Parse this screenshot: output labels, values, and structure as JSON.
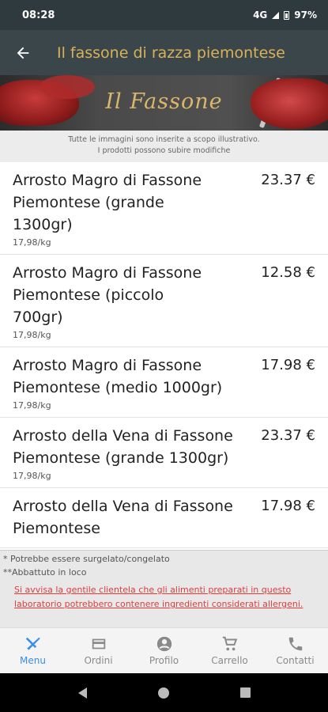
{
  "status": {
    "time": "08:28",
    "network": "4G",
    "battery": "97%"
  },
  "appbar": {
    "title": "Il fassone di razza piemontese"
  },
  "banner": {
    "text": "Il Fassone"
  },
  "notice": {
    "line1": "Tutte le immagini sono inserite a scopo illustrativo.",
    "line2": "I prodotti possono subire modifiche"
  },
  "products": [
    {
      "name": "Arrosto Magro di Fassone Piemontese (grande 1300gr)",
      "per_kg": "17,98/kg",
      "price": "23.37 €"
    },
    {
      "name": "Arrosto Magro di Fassone Piemontese (piccolo 700gr)",
      "per_kg": "17,98/kg",
      "price": "12.58 €"
    },
    {
      "name": "Arrosto Magro di Fassone Piemontese (medio 1000gr)",
      "per_kg": "17,98/kg",
      "price": "17.98 €"
    },
    {
      "name": "Arrosto della Vena di Fassone Piemontese (grande 1300gr)",
      "per_kg": "17,98/kg",
      "price": "23.37 €"
    },
    {
      "name": "Arrosto della Vena di Fassone Piemontese",
      "per_kg": "",
      "price": "17.98 €"
    }
  ],
  "footnotes": {
    "note1": "* Potrebbe essere surgelato/congelato",
    "note2": "**Abbattuto in loco",
    "warning": "Si avvisa la gentile clientela che gli alimenti preparati in questo laboratorio potrebbero contenere ingredienti considerati allergeni."
  },
  "nav": [
    {
      "label": "Menu",
      "icon": "fork-knife-icon"
    },
    {
      "label": "Ordini",
      "icon": "card-icon"
    },
    {
      "label": "Profilo",
      "icon": "user-icon"
    },
    {
      "label": "Carrello",
      "icon": "cart-icon"
    },
    {
      "label": "Contatti",
      "icon": "phone-icon"
    }
  ],
  "colors": {
    "appbar": "#3b464b",
    "title": "#d8b15a",
    "active": "#3a8ee6",
    "warning": "#e23b3b"
  }
}
